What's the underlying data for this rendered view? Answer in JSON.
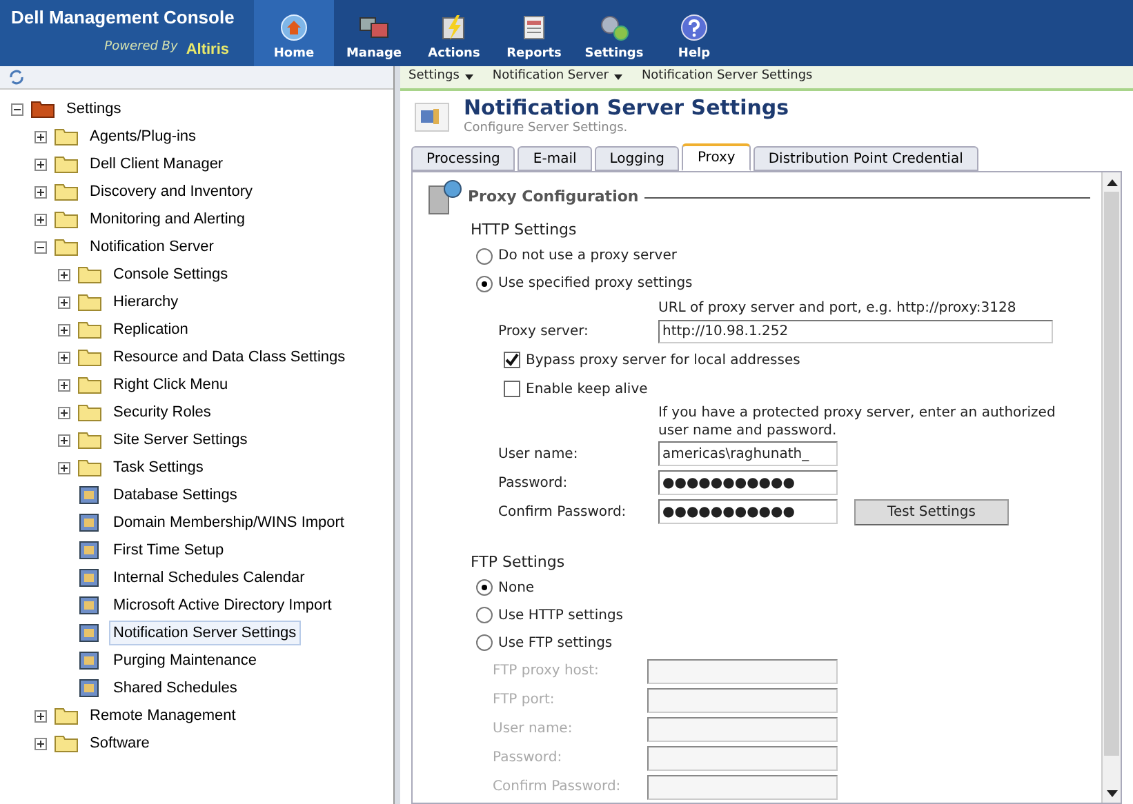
{
  "header": {
    "title": "Dell Management Console",
    "powered_by": "Powered By",
    "brand": "Altiris",
    "nav": [
      {
        "label": "Home",
        "selected": true
      },
      {
        "label": "Manage",
        "selected": false
      },
      {
        "label": "Actions",
        "selected": false
      },
      {
        "label": "Reports",
        "selected": false
      },
      {
        "label": "Settings",
        "selected": false
      },
      {
        "label": "Help",
        "selected": false
      }
    ]
  },
  "tree": [
    {
      "label": "Settings",
      "kind": "root",
      "expanded": true,
      "selected": false,
      "children": [
        {
          "label": "Agents/Plug-ins",
          "kind": "folder",
          "expanded": false,
          "selected": false
        },
        {
          "label": "Dell Client Manager",
          "kind": "folder",
          "expanded": false,
          "selected": false
        },
        {
          "label": "Discovery and Inventory",
          "kind": "folder",
          "expanded": false,
          "selected": false
        },
        {
          "label": "Monitoring and Alerting",
          "kind": "folder",
          "expanded": false,
          "selected": false
        },
        {
          "label": "Notification Server",
          "kind": "folder",
          "expanded": true,
          "selected": false,
          "children": [
            {
              "label": "Console Settings",
              "kind": "folder",
              "expanded": false,
              "selected": false
            },
            {
              "label": "Hierarchy",
              "kind": "folder",
              "expanded": false,
              "selected": false
            },
            {
              "label": "Replication",
              "kind": "folder",
              "expanded": false,
              "selected": false
            },
            {
              "label": "Resource and Data Class Settings",
              "kind": "folder",
              "expanded": false,
              "selected": false
            },
            {
              "label": "Right Click Menu",
              "kind": "folder",
              "expanded": false,
              "selected": false
            },
            {
              "label": "Security Roles",
              "kind": "folder",
              "expanded": false,
              "selected": false
            },
            {
              "label": "Site Server Settings",
              "kind": "folder",
              "expanded": false,
              "selected": false
            },
            {
              "label": "Task Settings",
              "kind": "folder",
              "expanded": false,
              "selected": false
            },
            {
              "label": "Database Settings",
              "kind": "page",
              "selected": false
            },
            {
              "label": "Domain Membership/WINS Import",
              "kind": "page",
              "selected": false
            },
            {
              "label": "First Time Setup",
              "kind": "page",
              "selected": false
            },
            {
              "label": "Internal Schedules Calendar",
              "kind": "page",
              "selected": false
            },
            {
              "label": "Microsoft Active Directory Import",
              "kind": "page",
              "selected": false
            },
            {
              "label": "Notification Server Settings",
              "kind": "page",
              "selected": true
            },
            {
              "label": "Purging Maintenance",
              "kind": "page",
              "selected": false
            },
            {
              "label": "Shared Schedules",
              "kind": "page",
              "selected": false
            }
          ]
        },
        {
          "label": "Remote Management",
          "kind": "folder",
          "expanded": false,
          "selected": false
        },
        {
          "label": "Software",
          "kind": "folder",
          "expanded": false,
          "selected": false
        }
      ]
    }
  ],
  "breadcrumb": [
    {
      "label": "Settings",
      "menu": true
    },
    {
      "label": "Notification Server",
      "menu": true
    },
    {
      "label": "Notification Server Settings",
      "menu": false
    }
  ],
  "page": {
    "title": "Notification Server Settings",
    "subtitle": "Configure Server Settings."
  },
  "tabs": [
    {
      "label": "Processing",
      "selected": false
    },
    {
      "label": "E-mail",
      "selected": false
    },
    {
      "label": "Logging",
      "selected": false
    },
    {
      "label": "Proxy",
      "selected": true
    },
    {
      "label": "Distribution Point Credential",
      "selected": false
    }
  ],
  "section": "Proxy Configuration",
  "http": {
    "heading": "HTTP Settings",
    "options": [
      {
        "label": "Do not use a proxy server",
        "selected": false
      },
      {
        "label": "Use specified proxy settings",
        "selected": true
      }
    ],
    "hint": "URL of proxy server and port, e.g. http://proxy:3128",
    "proxy_server": {
      "label": "Proxy server:",
      "value": "http://10.98.1.252"
    },
    "checkboxes": [
      {
        "label": "Bypass proxy server for local addresses",
        "checked": true
      },
      {
        "label": "Enable keep alive",
        "checked": false
      }
    ],
    "auth_hint": "If you have a protected proxy server, enter an authorized user name and password.",
    "fields": [
      {
        "label": "User name:",
        "value": "americas\\raghunath_"
      },
      {
        "label": "Password:",
        "value": "●●●●●●●●●●●"
      },
      {
        "label": "Confirm Password:",
        "value": "●●●●●●●●●●●"
      }
    ],
    "test_button": "Test Settings"
  },
  "ftp": {
    "heading": "FTP Settings",
    "options": [
      {
        "label": "None",
        "selected": true
      },
      {
        "label": "Use HTTP settings",
        "selected": false
      },
      {
        "label": "Use FTP settings",
        "selected": false
      }
    ],
    "fields": [
      {
        "label": "FTP proxy host:",
        "disabled": true
      },
      {
        "label": "FTP port:",
        "disabled": true
      },
      {
        "label": "User name:",
        "disabled": true
      },
      {
        "label": "Password:",
        "disabled": true
      },
      {
        "label": "Confirm Password:",
        "disabled": true
      }
    ]
  }
}
